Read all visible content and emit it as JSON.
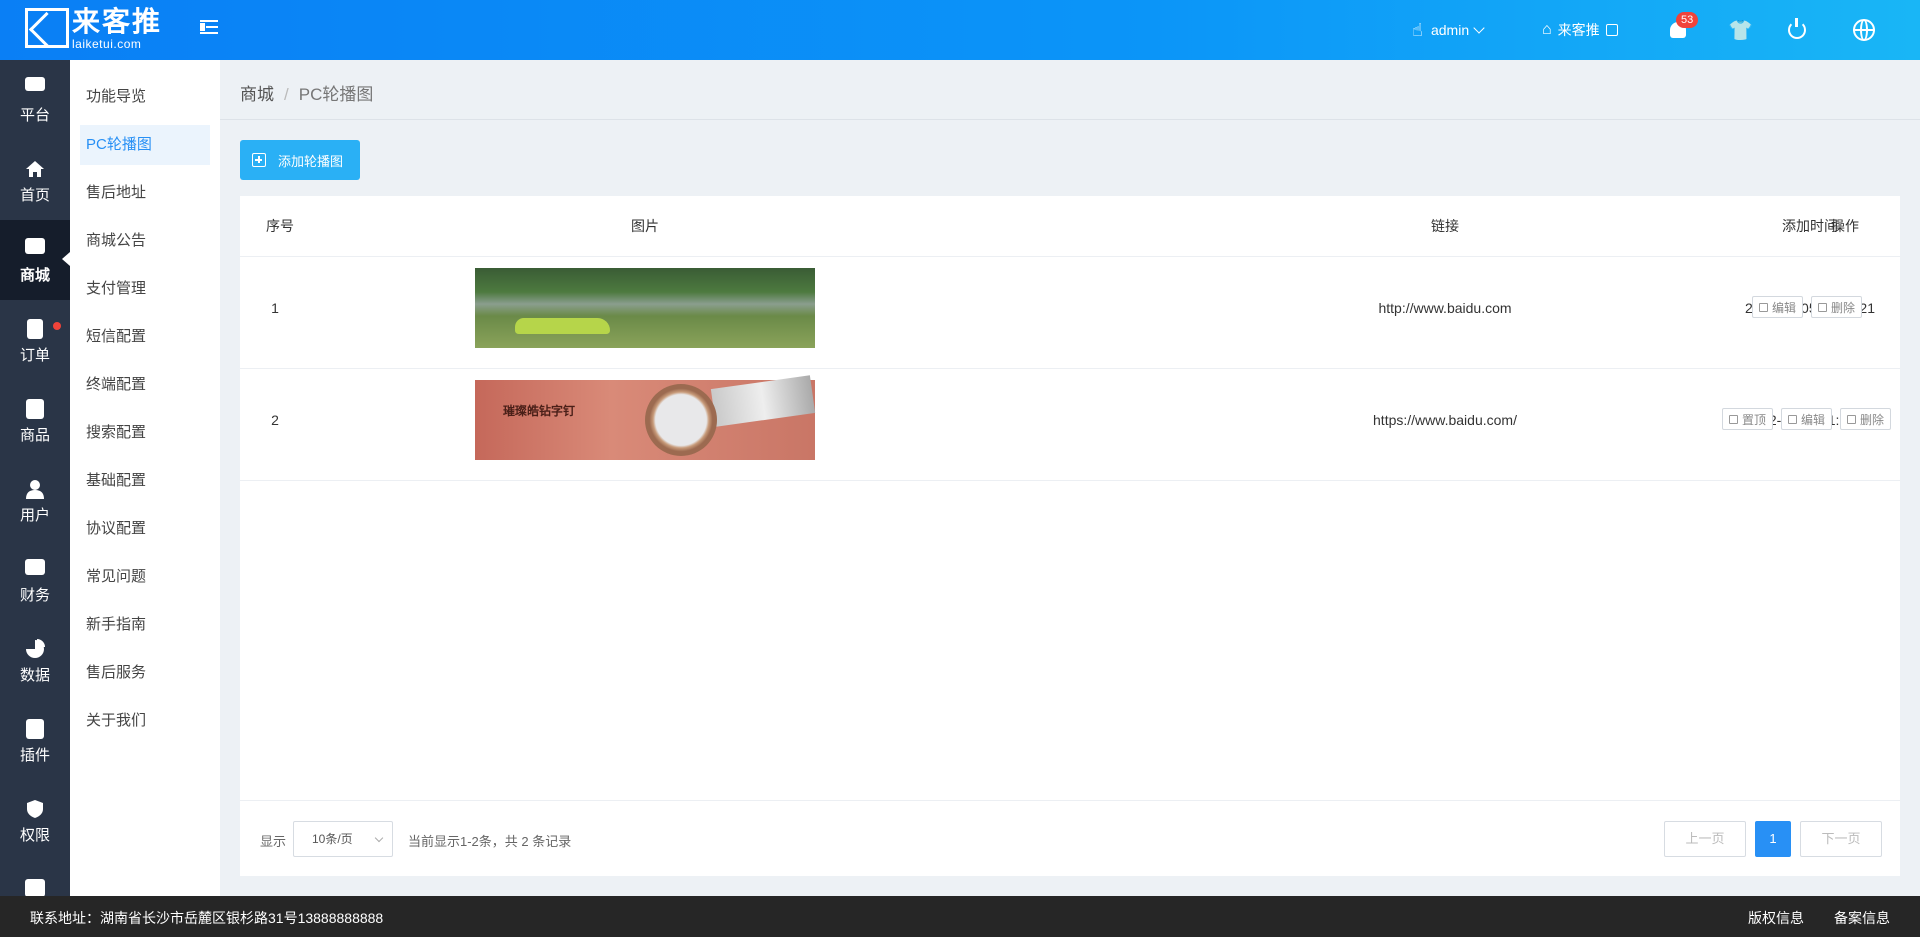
{
  "header": {
    "logo_cn": "来客推",
    "logo_en": "laiketui.com",
    "user": "admin",
    "store": "来客推",
    "notification_count": "53",
    "colors": {
      "primary": "#0a7ff5",
      "accent": "#2ab0f5",
      "badge": "#f0433a"
    }
  },
  "iconbar": {
    "items": [
      {
        "label": "平台",
        "icon": "platform-icon"
      },
      {
        "label": "首页",
        "icon": "home-icon"
      },
      {
        "label": "商城",
        "icon": "mall-icon",
        "active": true
      },
      {
        "label": "订单",
        "icon": "order-icon",
        "dot": true
      },
      {
        "label": "商品",
        "icon": "goods-icon"
      },
      {
        "label": "用户",
        "icon": "user-icon"
      },
      {
        "label": "财务",
        "icon": "wallet-icon"
      },
      {
        "label": "数据",
        "icon": "chart-icon"
      },
      {
        "label": "插件",
        "icon": "plugin-icon"
      },
      {
        "label": "权限",
        "icon": "shield-icon"
      }
    ]
  },
  "subbar": {
    "items": [
      {
        "label": "功能导览"
      },
      {
        "label": "PC轮播图",
        "active": true
      },
      {
        "label": "售后地址"
      },
      {
        "label": "商城公告"
      },
      {
        "label": "支付管理"
      },
      {
        "label": "短信配置"
      },
      {
        "label": "终端配置"
      },
      {
        "label": "搜索配置"
      },
      {
        "label": "基础配置"
      },
      {
        "label": "协议配置"
      },
      {
        "label": "常见问题"
      },
      {
        "label": "新手指南"
      },
      {
        "label": "售后服务"
      },
      {
        "label": "关于我们"
      }
    ]
  },
  "breadcrumb": {
    "root": "商城",
    "sep": "/",
    "current": "PC轮播图"
  },
  "add_button": "添加轮播图",
  "table": {
    "columns": [
      "序号",
      "图片",
      "链接",
      "添加时间",
      "操作"
    ],
    "rows": [
      {
        "no": "1",
        "image": "green-car-forest",
        "link": "http://www.baidu.com",
        "time": "2022-05-05 18:03:21",
        "ops": [
          "编辑",
          "删除"
        ]
      },
      {
        "no": "2",
        "image": "watch-banner",
        "image_text": "璀璨皓钻字钉",
        "link": "https://www.baidu.com/",
        "time": "2022-05-05 11:07:54",
        "ops": [
          "置顶",
          "编辑",
          "删除"
        ]
      }
    ]
  },
  "pagination": {
    "show_label": "显示",
    "page_size": "10条/页",
    "summary": "当前显示1-2条，共 2 条记录",
    "prev": "上一页",
    "current": "1",
    "next": "下一页"
  },
  "footer": {
    "address": "联系地址：湖南省长沙市岳麓区银杉路31号13888888888",
    "copyright": "版权信息",
    "filing": "备案信息"
  }
}
